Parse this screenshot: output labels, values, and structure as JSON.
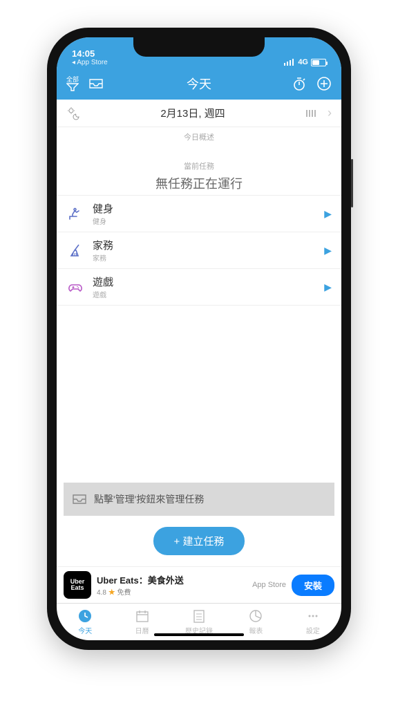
{
  "status": {
    "time": "14:05",
    "back": "◂ App Store",
    "network": "4G"
  },
  "header": {
    "filter_label": "全部",
    "title": "今天"
  },
  "date_bar": {
    "date": "2月13日, 週四"
  },
  "overview_label": "今日概述",
  "current_section": {
    "label": "當前任務",
    "empty": "無任務正在運行"
  },
  "tasks": [
    {
      "title": "健身",
      "sub": "健身"
    },
    {
      "title": "家務",
      "sub": "家務"
    },
    {
      "title": "遊戲",
      "sub": "遊戲"
    }
  ],
  "hint": "點擊'管理'按鈕來管理任務",
  "create_button": "+ 建立任務",
  "ad": {
    "icon_line1": "Uber",
    "icon_line2": "Eats",
    "title": "Uber Eats：美食外送",
    "rating": "4.8",
    "price": "免費",
    "store": "App Store",
    "install": "安裝"
  },
  "tabs": [
    {
      "label": "今天"
    },
    {
      "label": "日曆"
    },
    {
      "label": "歷史記錄"
    },
    {
      "label": "報表"
    },
    {
      "label": "設定"
    }
  ]
}
